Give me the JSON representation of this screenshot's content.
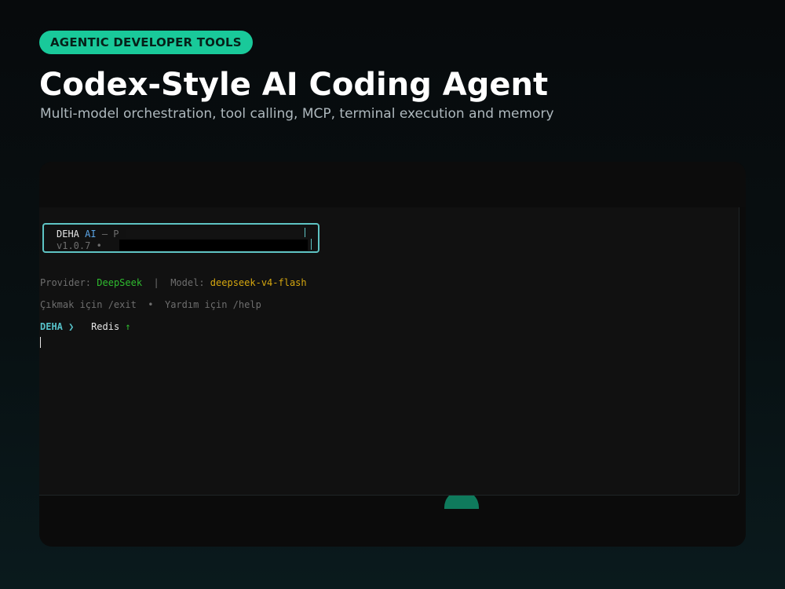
{
  "header": {
    "badge": "AGENTIC DEVELOPER TOOLS",
    "title": "Codex-Style AI Coding Agent",
    "subtitle": "Multi-model orchestration, tool calling, MCP, terminal execution and memory"
  },
  "terminal": {
    "banner": {
      "app_name": "DEHA",
      "app_suffix": "AI",
      "dash": "—",
      "tagline_start": "P",
      "version": "v1.0.7",
      "bullet": "•"
    },
    "provider_label": "Provider:",
    "provider_value": "DeepSeek",
    "separator": "|",
    "model_label": "Model:",
    "model_value": "deepseek-v4-flash",
    "exit_hint": "Çıkmak için /exit",
    "hint_bullet": "•",
    "help_hint": "Yardım için /help",
    "prompt_label": "DEHA",
    "prompt_arrow": "❯",
    "input_text": "Redis",
    "status_icon": "↑"
  },
  "colors": {
    "accent": "#19c99a",
    "terminal_border": "#5ec3c3",
    "provider": "#2fbb2f",
    "model": "#d6a70f",
    "prompt": "#56c1c9"
  },
  "icons": {
    "prompt_arrow": "chevron-right-icon",
    "status": "arrow-up-icon"
  }
}
